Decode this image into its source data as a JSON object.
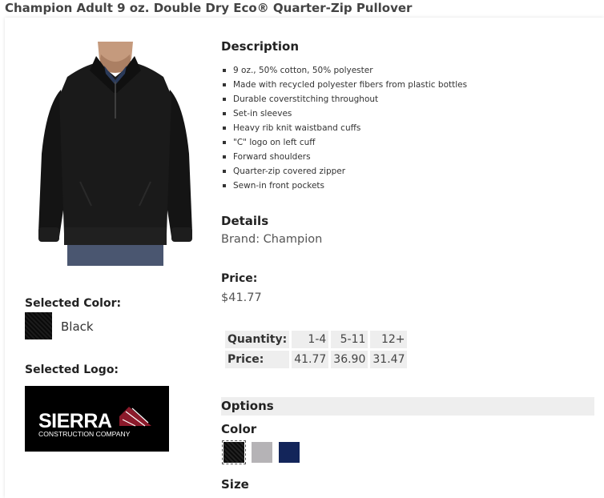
{
  "product": {
    "title": "Champion Adult 9 oz. Double Dry Eco® Quarter-Zip Pullover"
  },
  "selection": {
    "color_label": "Selected Color:",
    "color_value": "Black",
    "logo_label": "Selected Logo:",
    "logo": {
      "main_text": "SIERRA",
      "sub_text": "CONSTRUCTION COMPANY",
      "accent_color": "#8b1a2b"
    }
  },
  "description": {
    "heading": "Description",
    "items": [
      "9 oz., 50% cotton, 50% polyester",
      "Made with recycled polyester fibers from plastic bottles",
      "Durable coverstitching throughout",
      "Set-in sleeves",
      "Heavy rib knit waistband cuffs",
      "\"C\" logo on left cuff",
      "Forward shoulders",
      "Quarter-zip covered zipper",
      "Sewn-in front pockets"
    ]
  },
  "details": {
    "heading": "Details",
    "brand": "Brand: Champion"
  },
  "price": {
    "heading": "Price:",
    "value": "$41.77"
  },
  "pricing_table": {
    "quantity_label": "Quantity:",
    "price_label": "Price:",
    "tiers": [
      "1-4",
      "5-11",
      "12+"
    ],
    "prices": [
      "41.77",
      "36.90",
      "31.47"
    ]
  },
  "options": {
    "heading": "Options",
    "color_heading": "Color",
    "colors": [
      {
        "name": "black",
        "hex": "#151515"
      },
      {
        "name": "grey",
        "hex": "#b5b3b6"
      },
      {
        "name": "navy",
        "hex": "#13255a"
      }
    ],
    "size_heading": "Size"
  }
}
